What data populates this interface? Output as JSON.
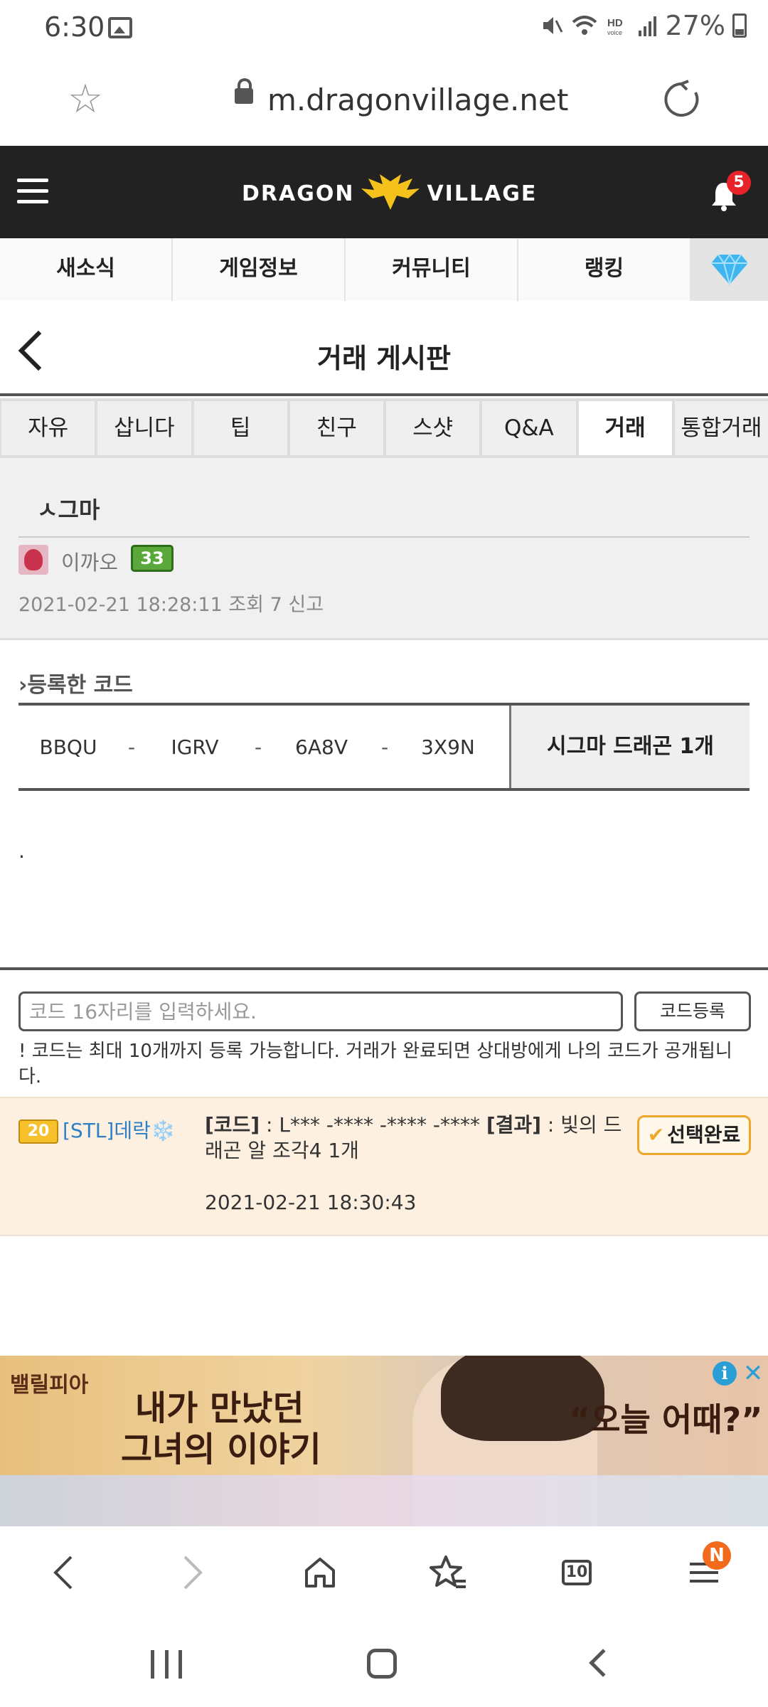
{
  "status_bar": {
    "time": "6:30",
    "battery": "27%",
    "icons": [
      "gallery-icon",
      "mute-icon",
      "wifi-icon",
      "hd-voice-icon",
      "signal-icon",
      "battery-icon"
    ]
  },
  "browser": {
    "url": "m.dragonvillage.net",
    "tabs_count": "10",
    "menu_badge": "N"
  },
  "site": {
    "logo_left": "DRAGON",
    "logo_right": "VILLAGE",
    "notification_count": "5",
    "nav": [
      "새소식",
      "게임정보",
      "커뮤니티",
      "랭킹"
    ]
  },
  "board": {
    "title": "거래 게시판",
    "sub_tabs": [
      "자유",
      "삽니다",
      "팁",
      "친구",
      "스샷",
      "Q&A",
      "거래",
      "통합거래"
    ],
    "active_tab": "거래"
  },
  "post": {
    "title": "ㅅ그마",
    "author": "이까오",
    "author_level": "33",
    "meta": "2021-02-21 18:28:11   조회 7   신고"
  },
  "code": {
    "section_label": "등록한 코드",
    "parts": [
      "BBQU",
      "IGRV",
      "6A8V",
      "3X9N"
    ],
    "separator": "-",
    "reward": "시그마 드래곤 1개"
  },
  "body": ".",
  "input": {
    "placeholder": "코드 16자리를 입력하세요.",
    "register_label": "코드등록",
    "notice": "! 코드는 최대 10개까지 등록 가능합니다. 거래가 완료되면 상대방에게 나의 코드가 공개됩니다."
  },
  "comment": {
    "level": "20",
    "user": "[STL]데락❄️",
    "code_label": "[코드]",
    "code_value": " : L*** -**** -**** -**** ",
    "result_label": "[결과]",
    "result_value": " : 빛의 드래곤 알 조각4 1개",
    "time": "2021-02-21 18:30:43",
    "select_label": "선택완료"
  },
  "ad": {
    "brand": "밸릴피아",
    "headline1": "내가 만났던",
    "headline2": "그녀의 이야기",
    "headline3": "“오늘 어때?”"
  }
}
